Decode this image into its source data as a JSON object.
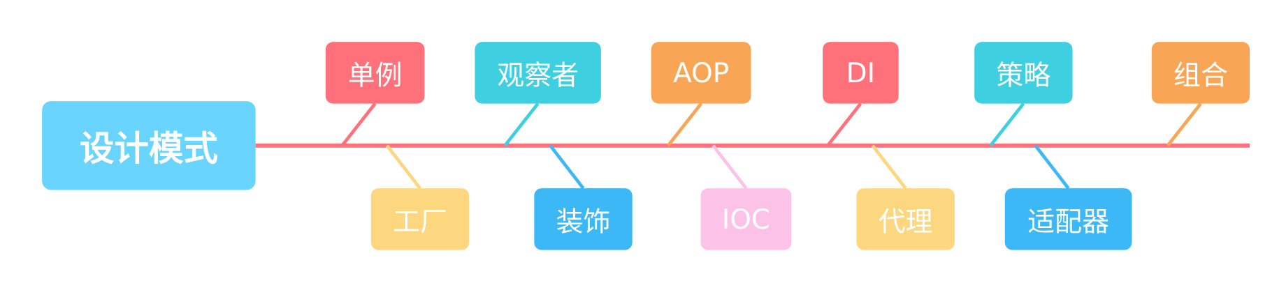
{
  "center": {
    "label": "设计模式",
    "color": "#69D5FE"
  },
  "spine_color": "#FF717A",
  "top_nodes": [
    {
      "label": "单例",
      "color": "#FF717A"
    },
    {
      "label": "观察者",
      "color": "#3ECFE0"
    },
    {
      "label": "AOP",
      "color": "#F9A556"
    },
    {
      "label": "DI",
      "color": "#FF717A"
    },
    {
      "label": "策略",
      "color": "#3ECFE0"
    },
    {
      "label": "组合",
      "color": "#F9A556"
    }
  ],
  "bottom_nodes": [
    {
      "label": "工厂",
      "color": "#FCD77F"
    },
    {
      "label": "装饰",
      "color": "#3DB8F7"
    },
    {
      "label": "IOC",
      "color": "#FDC2E8"
    },
    {
      "label": "代理",
      "color": "#FCD77F"
    },
    {
      "label": "适配器",
      "color": "#3DB8F7"
    }
  ]
}
